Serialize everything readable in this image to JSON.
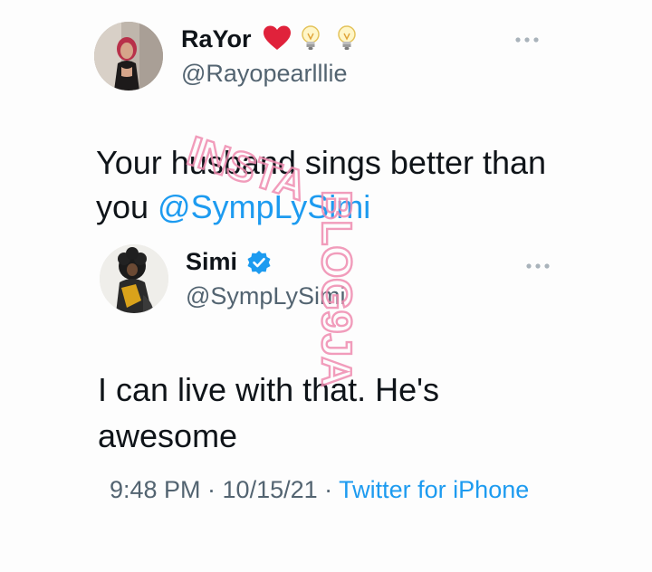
{
  "tweet": {
    "author_name": "RaYor",
    "author_handle": "@Rayopearlllie",
    "text_main": "Your husband sings better than you ",
    "mention": "@SympLySimi"
  },
  "reply": {
    "author_name": "Simi",
    "author_handle": "@SympLySimi",
    "text": "I can live with that. He's awesome",
    "time": "9:48 PM · 10/15/21 · ",
    "client": "Twitter for iPhone"
  },
  "watermark": {
    "text_1": "INSTA",
    "text_2": "BLOG9JA"
  },
  "colors": {
    "text": "#0f1419",
    "secondary": "#536471",
    "accent": "#1d9bf0",
    "watermark": "#f08cb0"
  }
}
